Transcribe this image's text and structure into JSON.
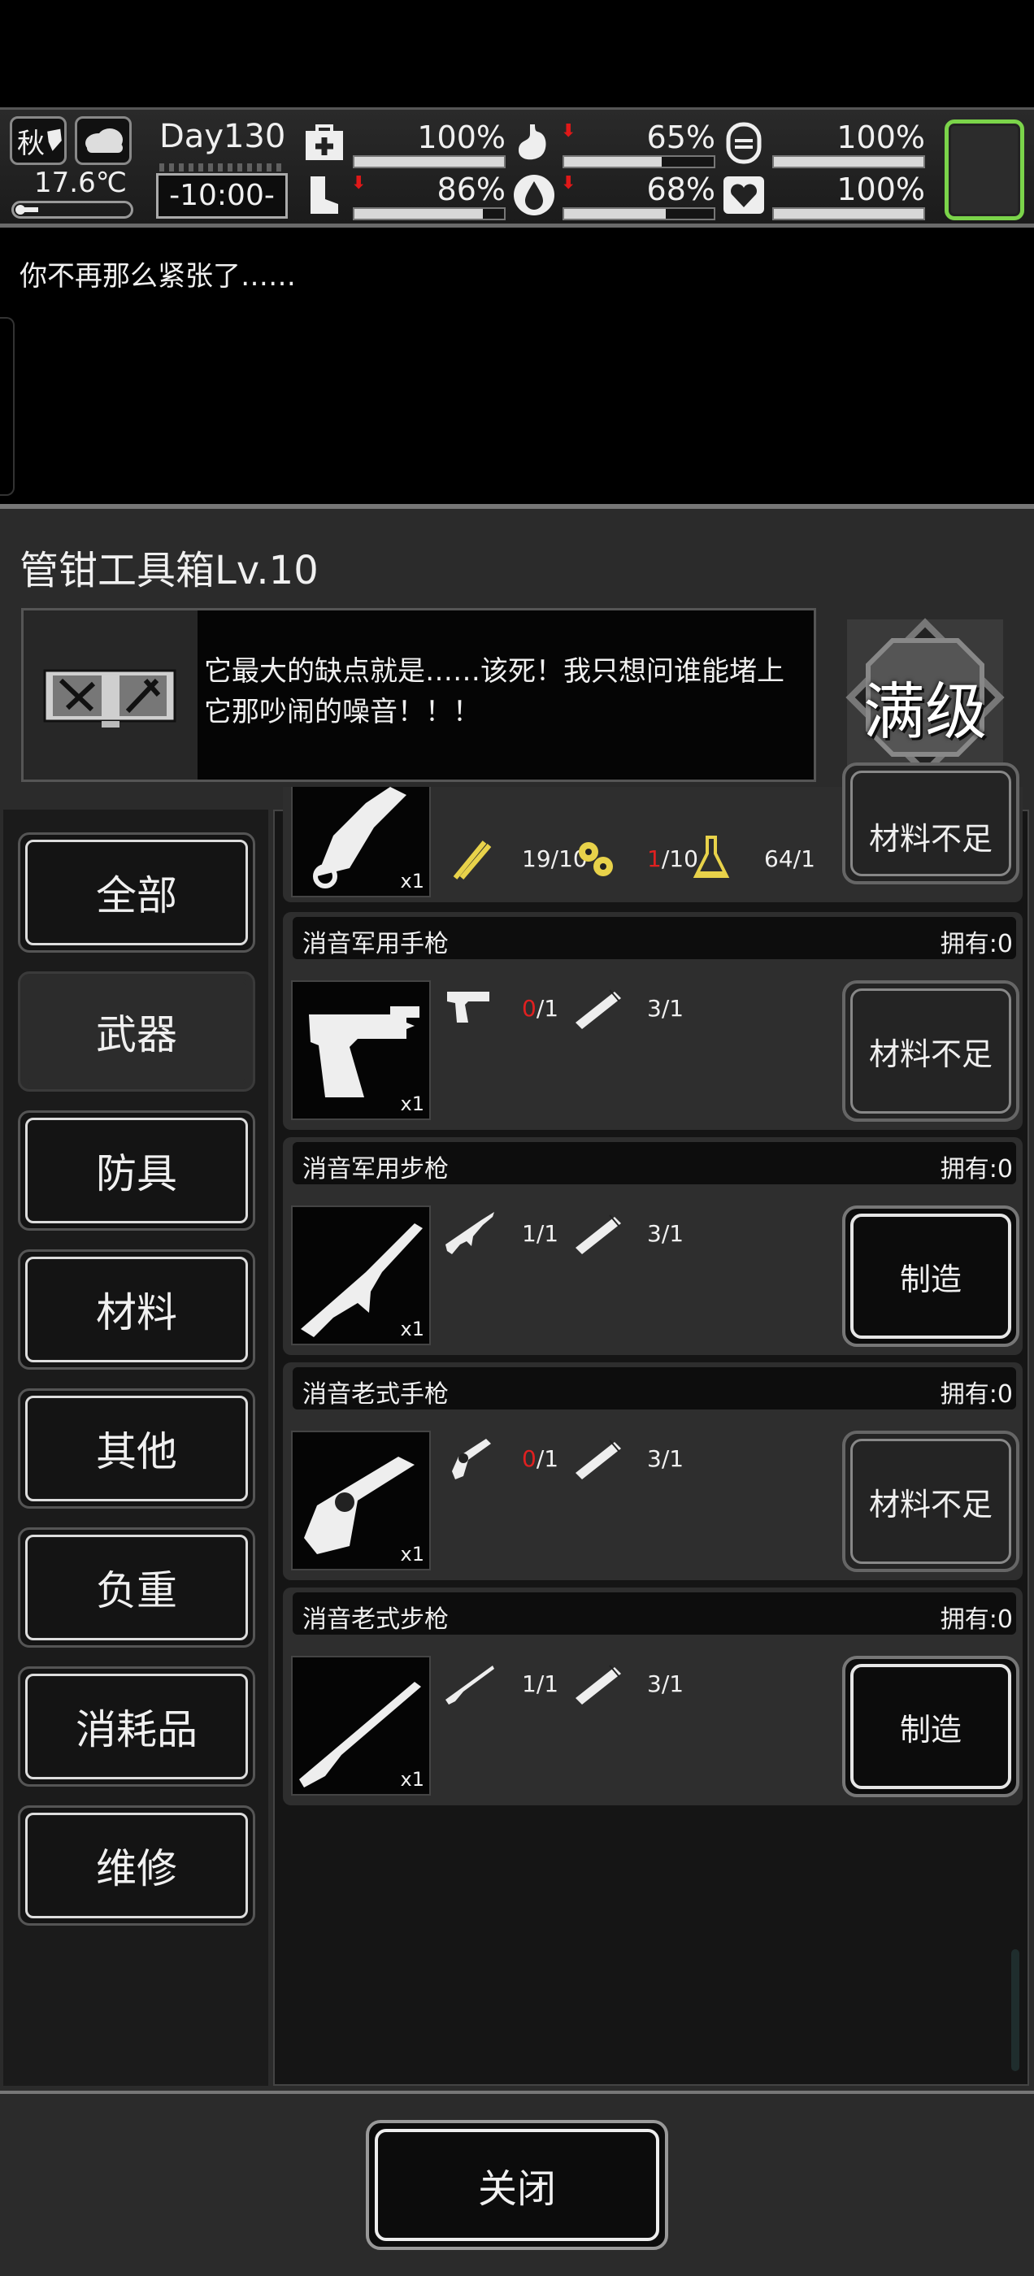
{
  "status": {
    "season": "秋",
    "temperature": "17.6℃",
    "day": "Day130",
    "clock": "-10:00-",
    "stats": [
      {
        "id": "health",
        "icon": "medkit-icon",
        "value": "100%",
        "fill": 1.0,
        "down": false
      },
      {
        "id": "hunger",
        "icon": "stomach-icon",
        "value": "65%",
        "fill": 0.65,
        "down": true
      },
      {
        "id": "mood",
        "icon": "face-icon",
        "value": "100%",
        "fill": 1.0,
        "down": false
      },
      {
        "id": "stamina",
        "icon": "boot-icon",
        "value": "86%",
        "fill": 0.86,
        "down": true
      },
      {
        "id": "thirst",
        "icon": "water-drop-icon",
        "value": "68%",
        "fill": 0.68,
        "down": true
      },
      {
        "id": "heart",
        "icon": "heart-icon",
        "value": "100%",
        "fill": 1.0,
        "down": false
      }
    ]
  },
  "message": "你不再那么紧张了……",
  "panel": {
    "title": "管钳工具箱Lv.10",
    "description": "它最大的缺点就是……该死！我只想问谁能堵上它那吵闹的噪音！！！",
    "max_level": "满级"
  },
  "categories": [
    {
      "label": "全部",
      "active": false
    },
    {
      "label": "武器",
      "active": true
    },
    {
      "label": "防具",
      "active": false
    },
    {
      "label": "材料",
      "active": false
    },
    {
      "label": "其他",
      "active": false
    },
    {
      "label": "负重",
      "active": false
    },
    {
      "label": "消耗品",
      "active": false
    },
    {
      "label": "维修",
      "active": false
    }
  ],
  "partial_item": {
    "qty": "x1",
    "materials": [
      {
        "icon": "gun-part-icon",
        "have": "19",
        "need": "/10",
        "short": false
      },
      {
        "icon": "gear-parts-icon",
        "have": "1",
        "need": "/10",
        "short": true
      },
      {
        "icon": "flask-icon",
        "have": "64",
        "need": "/1",
        "short": false
      }
    ],
    "button": "材料不足"
  },
  "items": [
    {
      "name": "消音军用手枪",
      "owned": "拥有:0",
      "qty": "x1",
      "materials": [
        {
          "icon": "pistol-icon",
          "have": "0",
          "need": "/1",
          "short": true
        },
        {
          "icon": "silencer-icon",
          "have": "3",
          "need": "/1",
          "short": false
        }
      ],
      "button": "材料不足",
      "enabled": false
    },
    {
      "name": "消音军用步枪",
      "owned": "拥有:0",
      "qty": "x1",
      "materials": [
        {
          "icon": "rifle-icon",
          "have": "1",
          "need": "/1",
          "short": false
        },
        {
          "icon": "silencer-icon",
          "have": "3",
          "need": "/1",
          "short": false
        }
      ],
      "button": "制造",
      "enabled": true
    },
    {
      "name": "消音老式手枪",
      "owned": "拥有:0",
      "qty": "x1",
      "materials": [
        {
          "icon": "revolver-icon",
          "have": "0",
          "need": "/1",
          "short": true
        },
        {
          "icon": "silencer-icon",
          "have": "3",
          "need": "/1",
          "short": false
        }
      ],
      "button": "材料不足",
      "enabled": false
    },
    {
      "name": "消音老式步枪",
      "owned": "拥有:0",
      "qty": "x1",
      "materials": [
        {
          "icon": "old-rifle-icon",
          "have": "1",
          "need": "/1",
          "short": false
        },
        {
          "icon": "silencer-icon",
          "have": "3",
          "need": "/1",
          "short": false
        }
      ],
      "button": "制造",
      "enabled": true
    }
  ],
  "close_label": "关闭"
}
